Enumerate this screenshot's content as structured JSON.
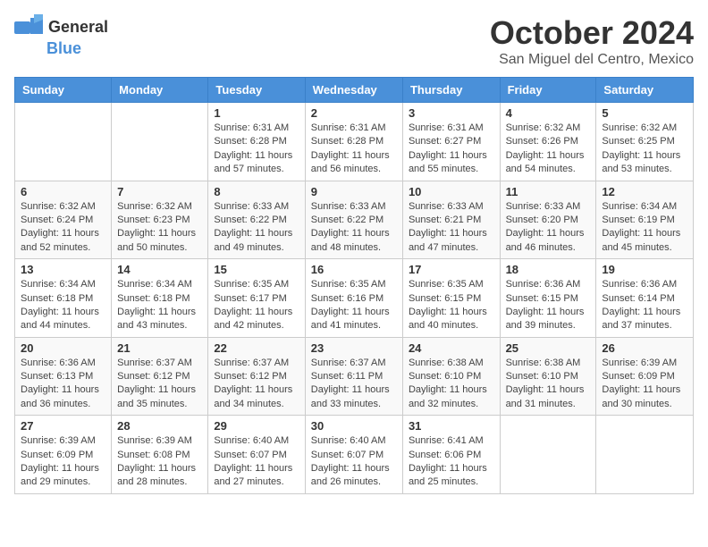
{
  "logo": {
    "general": "General",
    "blue": "Blue"
  },
  "header": {
    "month": "October 2024",
    "location": "San Miguel del Centro, Mexico"
  },
  "weekdays": [
    "Sunday",
    "Monday",
    "Tuesday",
    "Wednesday",
    "Thursday",
    "Friday",
    "Saturday"
  ],
  "weeks": [
    [
      {
        "day": "",
        "info": ""
      },
      {
        "day": "",
        "info": ""
      },
      {
        "day": "1",
        "info": "Sunrise: 6:31 AM\nSunset: 6:28 PM\nDaylight: 11 hours and 57 minutes."
      },
      {
        "day": "2",
        "info": "Sunrise: 6:31 AM\nSunset: 6:28 PM\nDaylight: 11 hours and 56 minutes."
      },
      {
        "day": "3",
        "info": "Sunrise: 6:31 AM\nSunset: 6:27 PM\nDaylight: 11 hours and 55 minutes."
      },
      {
        "day": "4",
        "info": "Sunrise: 6:32 AM\nSunset: 6:26 PM\nDaylight: 11 hours and 54 minutes."
      },
      {
        "day": "5",
        "info": "Sunrise: 6:32 AM\nSunset: 6:25 PM\nDaylight: 11 hours and 53 minutes."
      }
    ],
    [
      {
        "day": "6",
        "info": "Sunrise: 6:32 AM\nSunset: 6:24 PM\nDaylight: 11 hours and 52 minutes."
      },
      {
        "day": "7",
        "info": "Sunrise: 6:32 AM\nSunset: 6:23 PM\nDaylight: 11 hours and 50 minutes."
      },
      {
        "day": "8",
        "info": "Sunrise: 6:33 AM\nSunset: 6:22 PM\nDaylight: 11 hours and 49 minutes."
      },
      {
        "day": "9",
        "info": "Sunrise: 6:33 AM\nSunset: 6:22 PM\nDaylight: 11 hours and 48 minutes."
      },
      {
        "day": "10",
        "info": "Sunrise: 6:33 AM\nSunset: 6:21 PM\nDaylight: 11 hours and 47 minutes."
      },
      {
        "day": "11",
        "info": "Sunrise: 6:33 AM\nSunset: 6:20 PM\nDaylight: 11 hours and 46 minutes."
      },
      {
        "day": "12",
        "info": "Sunrise: 6:34 AM\nSunset: 6:19 PM\nDaylight: 11 hours and 45 minutes."
      }
    ],
    [
      {
        "day": "13",
        "info": "Sunrise: 6:34 AM\nSunset: 6:18 PM\nDaylight: 11 hours and 44 minutes."
      },
      {
        "day": "14",
        "info": "Sunrise: 6:34 AM\nSunset: 6:18 PM\nDaylight: 11 hours and 43 minutes."
      },
      {
        "day": "15",
        "info": "Sunrise: 6:35 AM\nSunset: 6:17 PM\nDaylight: 11 hours and 42 minutes."
      },
      {
        "day": "16",
        "info": "Sunrise: 6:35 AM\nSunset: 6:16 PM\nDaylight: 11 hours and 41 minutes."
      },
      {
        "day": "17",
        "info": "Sunrise: 6:35 AM\nSunset: 6:15 PM\nDaylight: 11 hours and 40 minutes."
      },
      {
        "day": "18",
        "info": "Sunrise: 6:36 AM\nSunset: 6:15 PM\nDaylight: 11 hours and 39 minutes."
      },
      {
        "day": "19",
        "info": "Sunrise: 6:36 AM\nSunset: 6:14 PM\nDaylight: 11 hours and 37 minutes."
      }
    ],
    [
      {
        "day": "20",
        "info": "Sunrise: 6:36 AM\nSunset: 6:13 PM\nDaylight: 11 hours and 36 minutes."
      },
      {
        "day": "21",
        "info": "Sunrise: 6:37 AM\nSunset: 6:12 PM\nDaylight: 11 hours and 35 minutes."
      },
      {
        "day": "22",
        "info": "Sunrise: 6:37 AM\nSunset: 6:12 PM\nDaylight: 11 hours and 34 minutes."
      },
      {
        "day": "23",
        "info": "Sunrise: 6:37 AM\nSunset: 6:11 PM\nDaylight: 11 hours and 33 minutes."
      },
      {
        "day": "24",
        "info": "Sunrise: 6:38 AM\nSunset: 6:10 PM\nDaylight: 11 hours and 32 minutes."
      },
      {
        "day": "25",
        "info": "Sunrise: 6:38 AM\nSunset: 6:10 PM\nDaylight: 11 hours and 31 minutes."
      },
      {
        "day": "26",
        "info": "Sunrise: 6:39 AM\nSunset: 6:09 PM\nDaylight: 11 hours and 30 minutes."
      }
    ],
    [
      {
        "day": "27",
        "info": "Sunrise: 6:39 AM\nSunset: 6:09 PM\nDaylight: 11 hours and 29 minutes."
      },
      {
        "day": "28",
        "info": "Sunrise: 6:39 AM\nSunset: 6:08 PM\nDaylight: 11 hours and 28 minutes."
      },
      {
        "day": "29",
        "info": "Sunrise: 6:40 AM\nSunset: 6:07 PM\nDaylight: 11 hours and 27 minutes."
      },
      {
        "day": "30",
        "info": "Sunrise: 6:40 AM\nSunset: 6:07 PM\nDaylight: 11 hours and 26 minutes."
      },
      {
        "day": "31",
        "info": "Sunrise: 6:41 AM\nSunset: 6:06 PM\nDaylight: 11 hours and 25 minutes."
      },
      {
        "day": "",
        "info": ""
      },
      {
        "day": "",
        "info": ""
      }
    ]
  ]
}
